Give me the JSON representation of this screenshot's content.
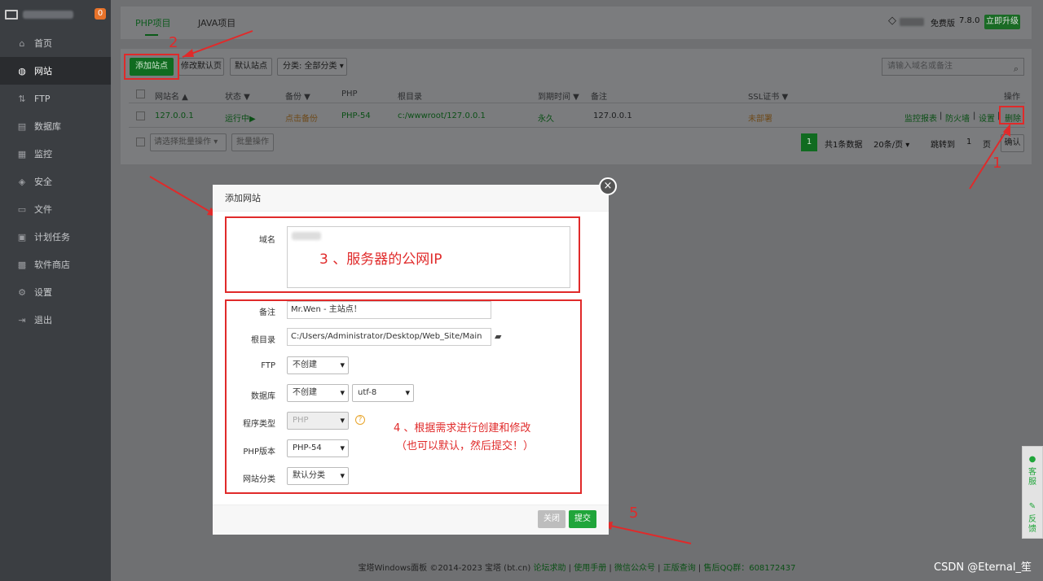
{
  "sidebar": {
    "badge": "0",
    "items": [
      {
        "icon": "home-icon",
        "glyph": "⌂",
        "label": "首页"
      },
      {
        "icon": "globe-icon",
        "glyph": "◍",
        "label": "网站"
      },
      {
        "icon": "ftp-icon",
        "glyph": "⇅",
        "label": "FTP"
      },
      {
        "icon": "database-icon",
        "glyph": "▤",
        "label": "数据库"
      },
      {
        "icon": "monitor-icon",
        "glyph": "▦",
        "label": "监控"
      },
      {
        "icon": "shield-icon",
        "glyph": "◈",
        "label": "安全"
      },
      {
        "icon": "folder-icon",
        "glyph": "▭",
        "label": "文件"
      },
      {
        "icon": "calendar-icon",
        "glyph": "▣",
        "label": "计划任务"
      },
      {
        "icon": "apps-icon",
        "glyph": "▩",
        "label": "软件商店"
      },
      {
        "icon": "gear-icon",
        "glyph": "⚙",
        "label": "设置"
      },
      {
        "icon": "logout-icon",
        "glyph": "⇥",
        "label": "退出"
      }
    ]
  },
  "header": {
    "tab_php": "PHP项目",
    "tab_java": "JAVA项目",
    "edition": "免费版",
    "version": "7.8.0",
    "upgrade": "立即升级"
  },
  "toolbar": {
    "add_site": "添加站点",
    "edit_default_page": "修改默认页",
    "default_site": "默认站点",
    "category": "分类: 全部分类",
    "search_placeholder": "请输入域名或备注"
  },
  "table": {
    "headers": [
      "网站名 ▲",
      "状态 ▼",
      "备份 ▼",
      "PHP",
      "根目录",
      "到期时间 ▼",
      "备注",
      "SSL证书 ▼",
      "操作"
    ],
    "row": {
      "name": "127.0.0.1",
      "status": "运行中▶",
      "backup": "点击备份",
      "php": "PHP-54",
      "root": "c:/wwwroot/127.0.0.1",
      "expire": "永久",
      "note": "127.0.0.1",
      "ssl": "未部署",
      "ops_report": "监控报表",
      "ops_sep": "|",
      "ops_firewall": "防火墙",
      "ops_settings": "设置",
      "ops_delete": "删除"
    },
    "batch_select": "请选择批量操作",
    "batch_btn": "批量操作",
    "page": "1",
    "total": "共1条数据",
    "per_page": "20条/页",
    "jump_to": "跳转到",
    "jump_page": "1",
    "page_unit": "页",
    "confirm": "确认"
  },
  "annotations": {
    "n1": "1",
    "n2": "2",
    "n3": "3 、服务器的公网IP",
    "n4_line1": "4 、根据需求进行创建和修改",
    "n4_line2": "（也可以默认，然后提交！）",
    "n5": "5"
  },
  "modal": {
    "title": "添加网站",
    "close": "×",
    "domain_label": "域名",
    "note_label": "备注",
    "note_value": "Mr.Wen - 主站点！",
    "root_label": "根目录",
    "root_value": "C:/Users/Administrator/Desktop/Web_Site/Main",
    "ftp_label": "FTP",
    "ftp_value": "不创建",
    "db_label": "数据库",
    "db_value": "不创建",
    "db_charset": "utf-8",
    "type_label": "程序类型",
    "type_value": "PHP",
    "php_label": "PHP版本",
    "php_value": "PHP-54",
    "cat_label": "网站分类",
    "cat_value": "默认分类",
    "help": "?",
    "btn_close": "关闭",
    "btn_submit": "提交"
  },
  "footer": {
    "copyright": "宝塔Windows面板 ©2014-2023 宝塔 (bt.cn)",
    "forum": "论坛求助",
    "manual": "使用手册",
    "wechat": "微信公众号",
    "verify": "正版查询",
    "qq": "售后QQ群：608172437",
    "sep": "|"
  },
  "float": {
    "service": "客服",
    "feedback": "反馈"
  },
  "watermark": "CSDN @Eternal_笙",
  "colors": {
    "accent": "#20a53a",
    "annotation": "#e02a2a",
    "sidebar": "#3b3e42"
  }
}
